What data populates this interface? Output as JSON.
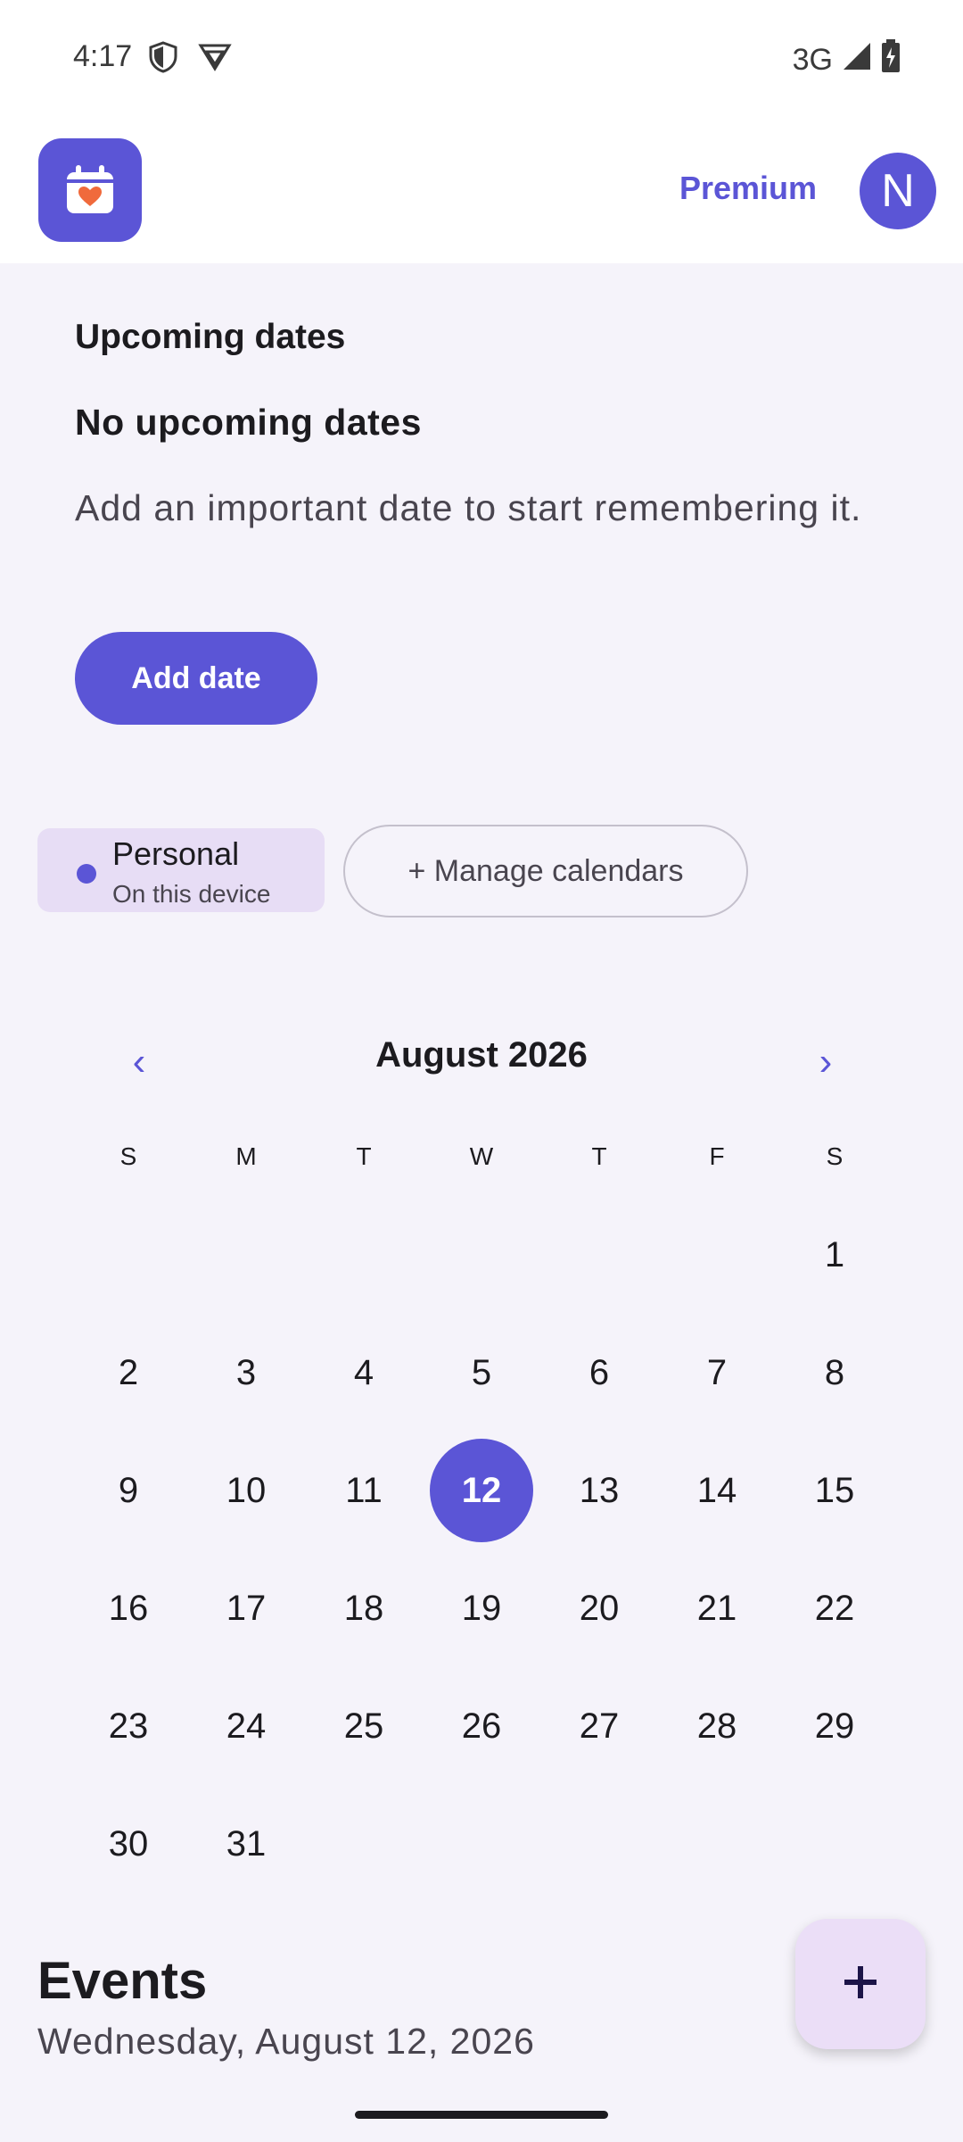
{
  "status_bar": {
    "time": "4:17",
    "network": "3G"
  },
  "app_bar": {
    "premium_label": "Premium",
    "avatar_initial": "N"
  },
  "upcoming": {
    "title": "Upcoming dates",
    "empty_title": "No upcoming dates",
    "empty_description": "Add an important date to start remembering it.",
    "add_button_label": "Add date"
  },
  "calendars": {
    "personal_label": "Personal",
    "personal_sub": "On this device",
    "manage_label": "+ Manage calendars"
  },
  "calendar": {
    "month_title": "August 2026",
    "prev_icon": "‹",
    "next_icon": "›",
    "weekdays": [
      "S",
      "M",
      "T",
      "W",
      "T",
      "F",
      "S"
    ],
    "first_weekday_index": 6,
    "days_in_month": 31,
    "selected_day": 12
  },
  "events": {
    "title": "Events",
    "date": "Wednesday, August 12, 2026"
  },
  "colors": {
    "accent": "#5b55d6",
    "chip_bg": "#e7ddf5",
    "fab_bg": "#ebdef7",
    "logo_heart": "#f06a3c"
  },
  "icons": {
    "logo": "calendar-heart-icon",
    "fab": "plus-icon"
  }
}
